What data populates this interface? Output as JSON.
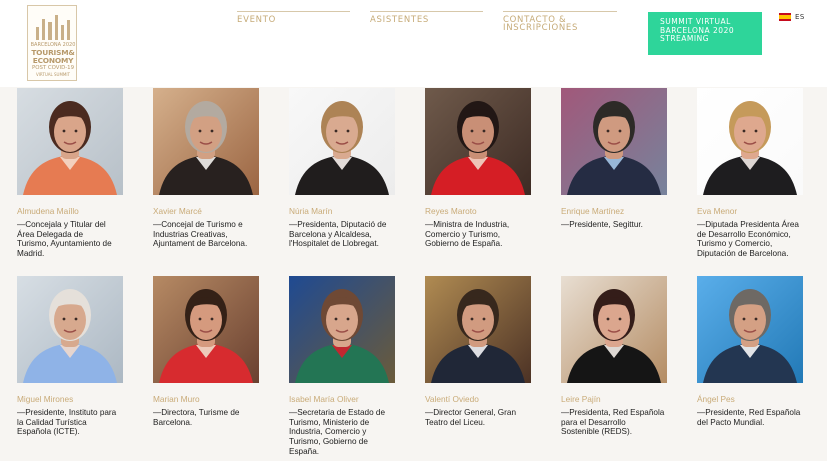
{
  "header": {
    "logo": {
      "line1": "BARCELONA 2020",
      "line2": "TOURISM&",
      "line3": "ECONOMY",
      "line4": "POST COVID-19",
      "line5": "VIRTUAL SUMMIT"
    },
    "nav": {
      "evento": "EVENTO",
      "asistentes": "ASISTENTES",
      "contacto": "CONTACTO &\nINSCRIPCIONES"
    },
    "summit_button": "SUMMIT VIRTUAL\nBARCELONA 2020\nSTREAMING",
    "language": "ES"
  },
  "speakers": [
    {
      "name": "Almudena Maíllo",
      "role": "—Concejala y Titular del\nÁrea Delegada de\nTurismo, Ayuntamiento de\nMadrid.",
      "photo": {
        "bg": "#b7c0c8",
        "bg2": "#d7dde2",
        "skin": "#d9a58a",
        "hair": "#4b2b20",
        "cloth": "#e67b52",
        "accent": "#f4d9c9"
      }
    },
    {
      "name": "Xavier Marcé",
      "role": "—Concejal de Turismo e\nIndustrias Creativas,\nAjuntament de Barcelona.",
      "photo": {
        "bg": "#9b6542",
        "bg2": "#d5b08c",
        "skin": "#d2a083",
        "hair": "#b3aaa0",
        "cloth": "#28211f",
        "accent": "#f3f1ed"
      }
    },
    {
      "name": "Núria Marín",
      "role": "—Presidenta, Diputació de\nBarcelona y Alcaldesa,\nl'Hospitalet de Llobregat.",
      "photo": {
        "bg": "#ececec",
        "bg2": "#f8f8f8",
        "skin": "#d9aa90",
        "hair": "#ad8355",
        "cloth": "#201d1d",
        "accent": "#f7f2ee"
      }
    },
    {
      "name": "Reyes Maroto",
      "role": "—Ministra de Industria,\nComercio y Turismo,\nGobierno de España.",
      "photo": {
        "bg": "#3d2b24",
        "bg2": "#6f5a4b",
        "skin": "#c98f76",
        "hair": "#221715",
        "cloth": "#d51e25",
        "accent": "#f1d6c8"
      }
    },
    {
      "name": "Enrique Martínez",
      "role": "—Presidente, Segittur.",
      "photo": {
        "bg": "#77839c",
        "bg2": "#a1587a",
        "skin": "#cf9a80",
        "hair": "#2d2a27",
        "cloth": "#252c43",
        "accent": "#a5c6e8"
      }
    },
    {
      "name": "Eva Menor",
      "role": "—Diputada Presidenta Área\nde Desarrollo Económico,\nTurismo y Comercio,\nDiputación de Barcelona.",
      "photo": {
        "bg": "#fafafa",
        "bg2": "#ffffff",
        "skin": "#dea88e",
        "hair": "#c59a5a",
        "cloth": "#1e1d1f",
        "accent": "#f2ebe7"
      }
    },
    {
      "name": "Miguel Mirones",
      "role": "—Presidente, Instituto para\nla Calidad Turística\nEspañola (ICTE).",
      "photo": {
        "bg": "#acb8c3",
        "bg2": "#d7dee4",
        "skin": "#d7a98e",
        "hair": "#e5e0da",
        "cloth": "#8fb3e7",
        "accent": "#f0d8cb"
      }
    },
    {
      "name": "Marian Muro",
      "role": "—Directora, Turisme de\nBarcelona.",
      "photo": {
        "bg": "#6a4030",
        "bg2": "#b68a64",
        "skin": "#d59a7e",
        "hair": "#342117",
        "cloth": "#d72b2f",
        "accent": "#f0dbc9"
      }
    },
    {
      "name": "Isabel María Oliver",
      "role": "—Secretaria de Estado de\nTurismo, Ministerio de\nIndustria, Comercio y\nTurismo, Gobierno de\nEspaña.",
      "photo": {
        "bg": "#6b5b3a",
        "bg2": "#1f4a92",
        "skin": "#d8a68c",
        "hair": "#6f4935",
        "cloth": "#237554",
        "accent": "#d41f2c"
      }
    },
    {
      "name": "Valentí Oviedo",
      "role": "—Director General, Gran\nTeatro del Liceu.",
      "photo": {
        "bg": "#4c3225",
        "bg2": "#b08b52",
        "skin": "#d19b80",
        "hair": "#37281d",
        "cloth": "#202737",
        "accent": "#f2f3f5"
      }
    },
    {
      "name": "Leire Pajín",
      "role": "—Presidenta, Red Española\npara el Desarrollo\nSostenible (REDS).",
      "photo": {
        "bg": "#b48c63",
        "bg2": "#e8ded2",
        "skin": "#dba68e",
        "hair": "#341d19",
        "cloth": "#151515",
        "accent": "#f3ede8"
      }
    },
    {
      "name": "Ángel Pes",
      "role": "—Presidente, Red Española\ndel Pacto Mundial.",
      "photo": {
        "bg": "#2279b6",
        "bg2": "#5aaeea",
        "skin": "#d4a084",
        "hair": "#6e6964",
        "cloth": "#233651",
        "accent": "#f7f7f7"
      }
    }
  ]
}
